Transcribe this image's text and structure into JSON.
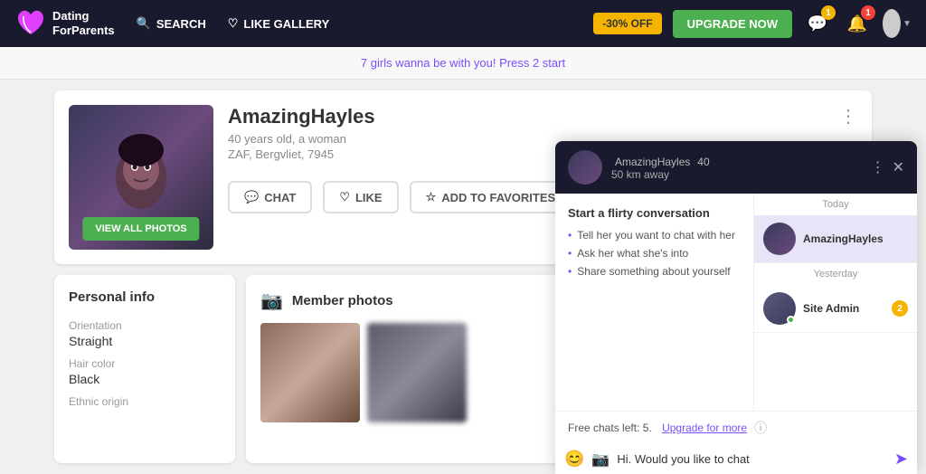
{
  "header": {
    "logo_line1": "Dating",
    "logo_line2": "ForParents",
    "search_label": "SEARCH",
    "like_gallery_label": "LIKE GALLERY",
    "discount_label": "-30% OFF",
    "upgrade_label": "UPGRADE NOW",
    "messages_count": "1",
    "notifications_count": "1"
  },
  "subheader": {
    "text": "7 girls wanna be with you! Press 2 start"
  },
  "profile": {
    "name": "AmazingHayles",
    "age": "40 years old, a woman",
    "location": "ZAF, Bergvliet, 7945",
    "view_photos_label": "VIEW ALL PHOTOS",
    "chat_label": "CHAT",
    "like_label": "LIKE",
    "add_favorites_label": "ADD TO FAVORITES"
  },
  "personal_info": {
    "title": "Personal info",
    "orientation_label": "Orientation",
    "orientation_value": "Straight",
    "hair_color_label": "Hair color",
    "hair_color_value": "Black",
    "ethnic_origin_label": "Ethnic origin"
  },
  "member_photos": {
    "title": "Member photos"
  },
  "chat": {
    "username": "AmazingHayles",
    "age": "40",
    "distance": "50 km away",
    "suggestions_title": "Start a flirty conversation",
    "suggestion_1": "Tell her you want to chat with her",
    "suggestion_2": "Ask her what she's into",
    "suggestion_3": "Share something about yourself",
    "free_chats_text": "Free chats left: 5.",
    "upgrade_link_text": "Upgrade for more",
    "input_value": "Hi. Would you like to chat",
    "today_label": "Today",
    "yesterday_label": "Yesterday",
    "conv1_name": "AmazingHayles",
    "conv2_name": "Site Admin",
    "conv2_badge": "2"
  }
}
